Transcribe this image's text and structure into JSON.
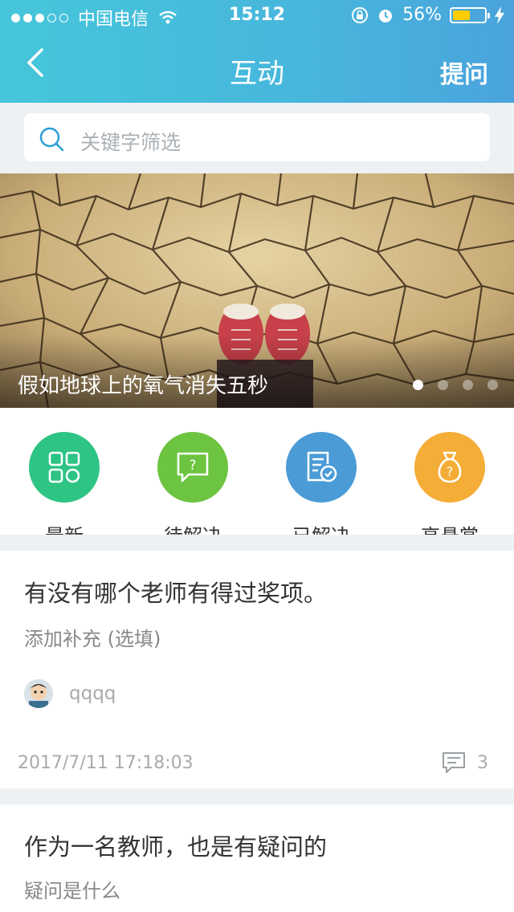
{
  "status_bar": {
    "carrier": "中国电信",
    "time": "15:12",
    "battery": "56%",
    "battery_level": 0.56,
    "signal_bars": 3
  },
  "nav": {
    "title": "互动",
    "ask_label": "提问"
  },
  "search": {
    "placeholder": "关键字筛选"
  },
  "banner": {
    "caption": "假如地球上的氧气消失五秒",
    "page_count": 4,
    "active_page": 0
  },
  "categories": [
    {
      "label": "最新",
      "color": "#2ec484",
      "icon": "grid-icon"
    },
    {
      "label": "待解决",
      "color": "#6cc440",
      "icon": "question-bubble-icon"
    },
    {
      "label": "已解决",
      "color": "#4b9bd6",
      "icon": "checked-document-icon"
    },
    {
      "label": "高悬赏",
      "color": "#f4ad37",
      "icon": "money-bag-icon"
    }
  ],
  "posts": [
    {
      "title": "有没有哪个老师有得过奖项。",
      "subtitle": "添加补充 (选填)",
      "user": "qqqq",
      "timestamp": "2017/7/11 17:18:03",
      "comment_count": "3"
    },
    {
      "title": "作为一名教师，也是有疑问的",
      "subtitle": "疑问是什么"
    }
  ],
  "colors": {
    "header_start": "#46c6da",
    "header_end": "#4aa3dc",
    "background": "#eef1f3"
  }
}
